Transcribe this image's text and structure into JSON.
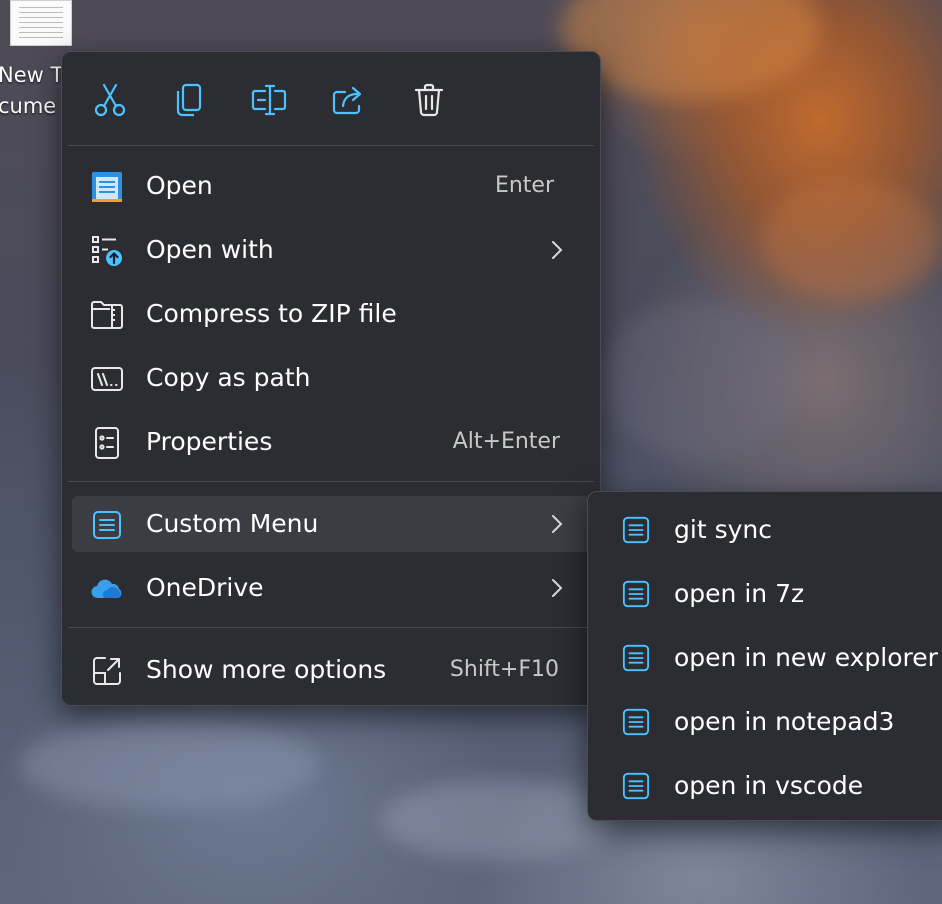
{
  "desktop": {
    "icon_label": "New Te\ncume"
  },
  "toolbar": {
    "buttons": [
      {
        "name": "cut",
        "icon": "scissors-icon"
      },
      {
        "name": "copy",
        "icon": "copy-icon"
      },
      {
        "name": "rename",
        "icon": "rename-icon"
      },
      {
        "name": "share",
        "icon": "share-icon"
      },
      {
        "name": "delete",
        "icon": "trash-icon"
      }
    ],
    "accent": "#4cc2ff"
  },
  "menu": {
    "items": [
      {
        "label": "Open",
        "shortcut": "Enter",
        "icon": "notepad-icon"
      },
      {
        "label": "Open with",
        "shortcut": "",
        "icon": "open-with-icon",
        "submenu": true
      },
      {
        "label": "Compress to ZIP file",
        "shortcut": "",
        "icon": "zip-folder-icon"
      },
      {
        "label": "Copy as path",
        "shortcut": "",
        "icon": "copy-path-icon"
      },
      {
        "label": "Properties",
        "shortcut": "Alt+Enter",
        "icon": "properties-icon"
      },
      {
        "label": "Custom Menu",
        "shortcut": "",
        "icon": "list-icon",
        "submenu": true,
        "highlighted": true
      },
      {
        "label": "OneDrive",
        "shortcut": "",
        "icon": "onedrive-icon",
        "submenu": true
      },
      {
        "label": "Show more options",
        "shortcut": "Shift+F10",
        "icon": "show-more-icon"
      }
    ]
  },
  "submenu": {
    "items": [
      {
        "label": "git sync",
        "icon": "list-icon"
      },
      {
        "label": "open in 7z",
        "icon": "list-icon"
      },
      {
        "label": "open in new explorer",
        "icon": "list-icon"
      },
      {
        "label": "open in notepad3",
        "icon": "list-icon"
      },
      {
        "label": "open in vscode",
        "icon": "list-icon"
      }
    ]
  },
  "colors": {
    "menu_bg": "#2b2d33",
    "hover_bg": "#3b3d44",
    "icon_blue": "#4cc2ff",
    "text": "#ffffff",
    "shortcut_text": "#c8c8c8"
  }
}
